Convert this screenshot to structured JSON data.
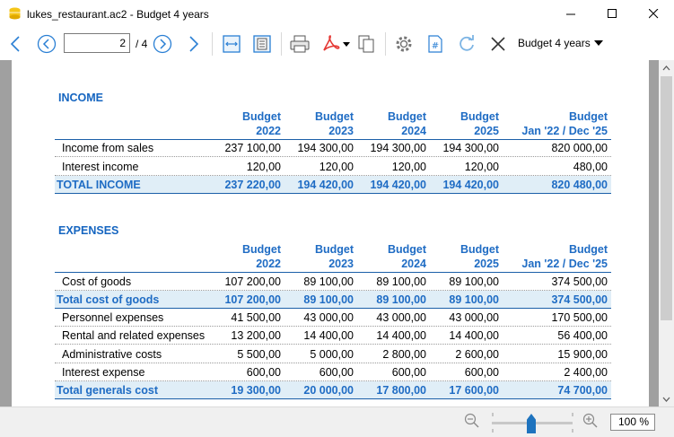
{
  "window": {
    "title": "lukes_restaurant.ac2 - Budget 4 years"
  },
  "toolbar": {
    "current_page": "2",
    "page_total": "/ 4",
    "view_selected": "Budget 4 years"
  },
  "report": {
    "columns": [
      "Budget\n2022",
      "Budget\n2023",
      "Budget\n2024",
      "Budget\n2025",
      "Budget\nJan '22 / Dec '25"
    ],
    "income": {
      "title": "INCOME",
      "col_headers": [
        {
          "top": "Budget",
          "bottom": "2022"
        },
        {
          "top": "Budget",
          "bottom": "2023"
        },
        {
          "top": "Budget",
          "bottom": "2024"
        },
        {
          "top": "Budget",
          "bottom": "2025"
        },
        {
          "top": "Budget",
          "bottom": "Jan '22 / Dec '25"
        }
      ],
      "rows": [
        {
          "label": "Income from sales",
          "values": [
            "237 100,00",
            "194 300,00",
            "194 300,00",
            "194 300,00",
            "820 000,00"
          ]
        },
        {
          "label": "Interest income",
          "values": [
            "120,00",
            "120,00",
            "120,00",
            "120,00",
            "480,00"
          ]
        }
      ],
      "total": {
        "label": "TOTAL INCOME",
        "values": [
          "237 220,00",
          "194 420,00",
          "194 420,00",
          "194 420,00",
          "820 480,00"
        ]
      }
    },
    "expenses": {
      "title": "EXPENSES",
      "col_headers": [
        {
          "top": "Budget",
          "bottom": "2022"
        },
        {
          "top": "Budget",
          "bottom": "2023"
        },
        {
          "top": "Budget",
          "bottom": "2024"
        },
        {
          "top": "Budget",
          "bottom": "2025"
        },
        {
          "top": "Budget",
          "bottom": "Jan '22 / Dec '25"
        }
      ],
      "cogs_row": {
        "label": "Cost of goods",
        "values": [
          "107 200,00",
          "89 100,00",
          "89 100,00",
          "89 100,00",
          "374 500,00"
        ]
      },
      "cogs_total": {
        "label": "Total cost of goods",
        "values": [
          "107 200,00",
          "89 100,00",
          "89 100,00",
          "89 100,00",
          "374 500,00"
        ]
      },
      "general_rows": [
        {
          "label": "Personnel expenses",
          "values": [
            "41 500,00",
            "43 000,00",
            "43 000,00",
            "43 000,00",
            "170 500,00"
          ]
        },
        {
          "label": "Rental and related expenses",
          "values": [
            "13 200,00",
            "14 400,00",
            "14 400,00",
            "14 400,00",
            "56 400,00"
          ]
        },
        {
          "label": "Administrative costs",
          "values": [
            "5 500,00",
            "5 000,00",
            "2 800,00",
            "2 600,00",
            "15 900,00"
          ]
        },
        {
          "label": "Interest expense",
          "values": [
            "600,00",
            "600,00",
            "600,00",
            "600,00",
            "2 400,00"
          ]
        }
      ],
      "general_total": {
        "label": "Total generals cost",
        "values": [
          "19 300,00",
          "20 000,00",
          "17 800,00",
          "17 600,00",
          "74 700,00"
        ]
      }
    }
  },
  "statusbar": {
    "zoom": "100 %",
    "zoom_level_percent": 100
  },
  "colors": {
    "accent": "#1f6cc4",
    "total_row_bg": "#e0eef7",
    "doc_background": "#a0a0a0"
  }
}
